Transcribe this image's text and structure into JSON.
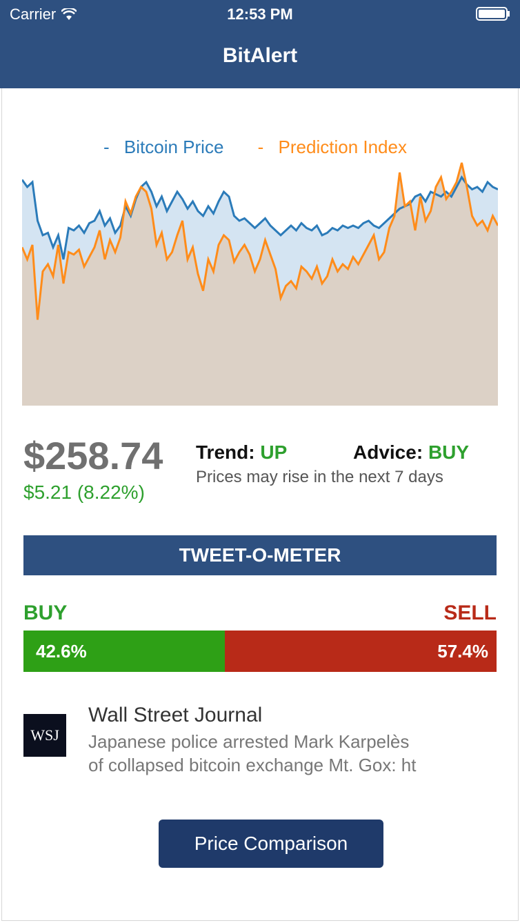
{
  "status_bar": {
    "carrier": "Carrier",
    "time": "12:53 PM"
  },
  "nav": {
    "title": "BitAlert"
  },
  "chart_data": {
    "type": "area",
    "series": [
      {
        "name": "Bitcoin Price",
        "color": "#2b7bb9",
        "values": [
          0.93,
          0.9,
          0.92,
          0.76,
          0.7,
          0.71,
          0.65,
          0.7,
          0.6,
          0.73,
          0.72,
          0.74,
          0.71,
          0.75,
          0.76,
          0.8,
          0.74,
          0.77,
          0.71,
          0.74,
          0.82,
          0.78,
          0.85,
          0.9,
          0.92,
          0.88,
          0.82,
          0.86,
          0.8,
          0.84,
          0.88,
          0.85,
          0.81,
          0.84,
          0.8,
          0.78,
          0.82,
          0.79,
          0.84,
          0.88,
          0.86,
          0.78,
          0.76,
          0.77,
          0.75,
          0.73,
          0.75,
          0.77,
          0.74,
          0.72,
          0.7,
          0.72,
          0.74,
          0.72,
          0.75,
          0.73,
          0.72,
          0.74,
          0.7,
          0.71,
          0.73,
          0.72,
          0.74,
          0.73,
          0.74,
          0.73,
          0.75,
          0.76,
          0.74,
          0.73,
          0.75,
          0.77,
          0.79,
          0.81,
          0.82,
          0.83,
          0.86,
          0.87,
          0.84,
          0.88,
          0.87,
          0.86,
          0.88,
          0.86,
          0.9,
          0.94,
          0.91,
          0.89,
          0.9,
          0.88,
          0.92,
          0.9,
          0.89
        ]
      },
      {
        "name": "Prediction Index",
        "color": "#ff8c1a",
        "values": [
          0.65,
          0.6,
          0.66,
          0.35,
          0.55,
          0.58,
          0.53,
          0.66,
          0.5,
          0.63,
          0.62,
          0.64,
          0.57,
          0.61,
          0.65,
          0.72,
          0.6,
          0.68,
          0.63,
          0.69,
          0.84,
          0.79,
          0.86,
          0.9,
          0.88,
          0.81,
          0.66,
          0.71,
          0.6,
          0.63,
          0.7,
          0.76,
          0.6,
          0.65,
          0.54,
          0.47,
          0.6,
          0.55,
          0.66,
          0.7,
          0.68,
          0.59,
          0.63,
          0.66,
          0.62,
          0.55,
          0.6,
          0.68,
          0.62,
          0.56,
          0.44,
          0.49,
          0.51,
          0.48,
          0.57,
          0.55,
          0.52,
          0.57,
          0.5,
          0.53,
          0.6,
          0.55,
          0.58,
          0.56,
          0.61,
          0.58,
          0.62,
          0.66,
          0.7,
          0.6,
          0.63,
          0.73,
          0.78,
          0.96,
          0.82,
          0.84,
          0.72,
          0.86,
          0.76,
          0.8,
          0.9,
          0.94,
          0.85,
          0.88,
          0.92,
          1.0,
          0.9,
          0.78,
          0.74,
          0.76,
          0.72,
          0.78,
          0.74
        ]
      }
    ]
  },
  "price": {
    "value": "$258.74",
    "change": "$5.21 (8.22%)"
  },
  "trend": {
    "label": "Trend: ",
    "value": "UP"
  },
  "advice": {
    "label": "Advice: ",
    "value": "BUY"
  },
  "hint": "Prices may rise in the next 7 days",
  "tweet_o_meter": {
    "title": "TWEET-O-METER",
    "buy_label": "BUY",
    "sell_label": "SELL",
    "buy_pct": "42.6%",
    "sell_pct": "57.4%",
    "buy_fraction": 0.426,
    "buy_color": "#2ea016",
    "sell_color": "#b82a18"
  },
  "news": {
    "logo_text": "WSJ",
    "source": "Wall Street Journal",
    "text": "Japanese police arrested Mark Karpelès\nof collapsed bitcoin exchange Mt. Gox: ht"
  },
  "button": {
    "label": "Price Comparison"
  }
}
